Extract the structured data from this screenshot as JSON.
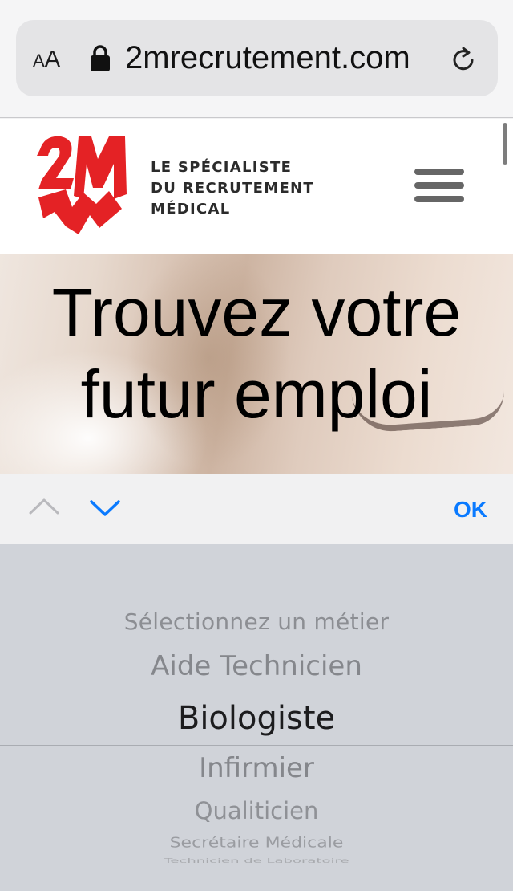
{
  "browser": {
    "text_size_label_small": "A",
    "text_size_label_big": "A",
    "url": "2mrecrutement.com",
    "icons": [
      "lock-icon",
      "reload-icon"
    ]
  },
  "site": {
    "logo_text": "2M",
    "tagline": [
      "LE SPÉCIALISTE",
      "DU RECRUTEMENT",
      "MÉDICAL"
    ],
    "brand_color": "#e42225"
  },
  "hero": {
    "title_line1": "Trouvez votre",
    "title_line2": "futur emploi"
  },
  "picker_toolbar": {
    "ok_label": "OK",
    "accent_color": "#0a7aff"
  },
  "picker": {
    "options": [
      "Sélectionnez un métier",
      "Aide Technicien",
      "Biologiste",
      "Infirmier",
      "Qualiticien",
      "Secrétaire Médicale",
      "Technicien de Laboratoire"
    ],
    "selected": "Biologiste"
  }
}
